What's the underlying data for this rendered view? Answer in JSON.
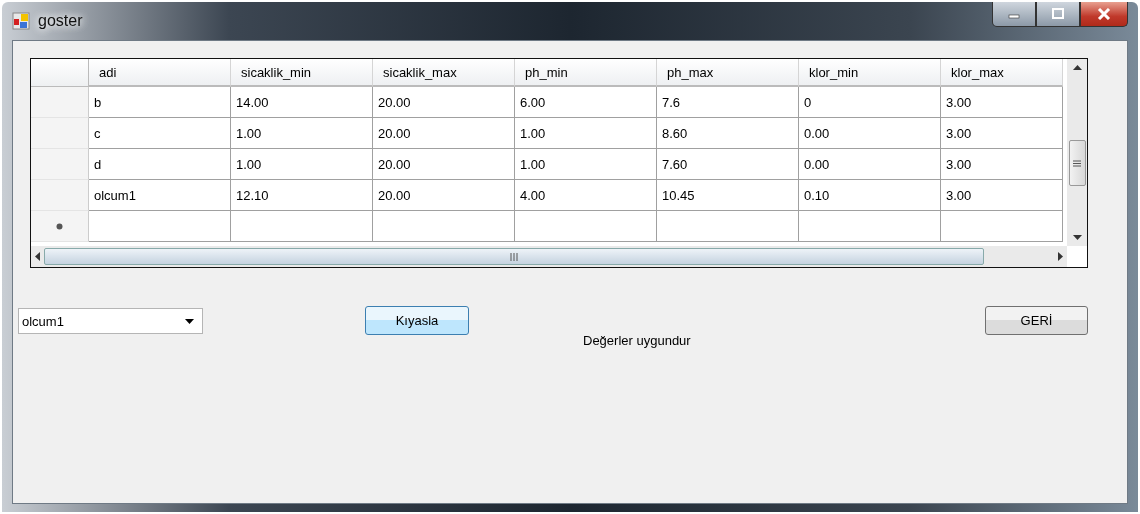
{
  "window": {
    "title": "goster"
  },
  "table": {
    "columns": [
      "adi",
      "sicaklik_min",
      "sicaklik_max",
      "ph_min",
      "ph_max",
      "klor_min",
      "klor_max"
    ],
    "rows": [
      [
        "b",
        "14.00",
        "20.00",
        "6.00",
        "7.6",
        "0",
        "3.00"
      ],
      [
        "c",
        "1.00",
        "20.00",
        "1.00",
        "8.60",
        "0.00",
        "3.00"
      ],
      [
        "d",
        "1.00",
        "20.00",
        "1.00",
        "7.60",
        "0.00",
        "3.00"
      ],
      [
        "olcum1",
        "12.10",
        "20.00",
        "4.00",
        "10.45",
        "0.10",
        "3.00"
      ]
    ],
    "new_row": true
  },
  "combo": {
    "value": "olcum1"
  },
  "compare_button": "Kıyasla",
  "status_label": "Değerler uygundur",
  "back_button": "GERİ"
}
